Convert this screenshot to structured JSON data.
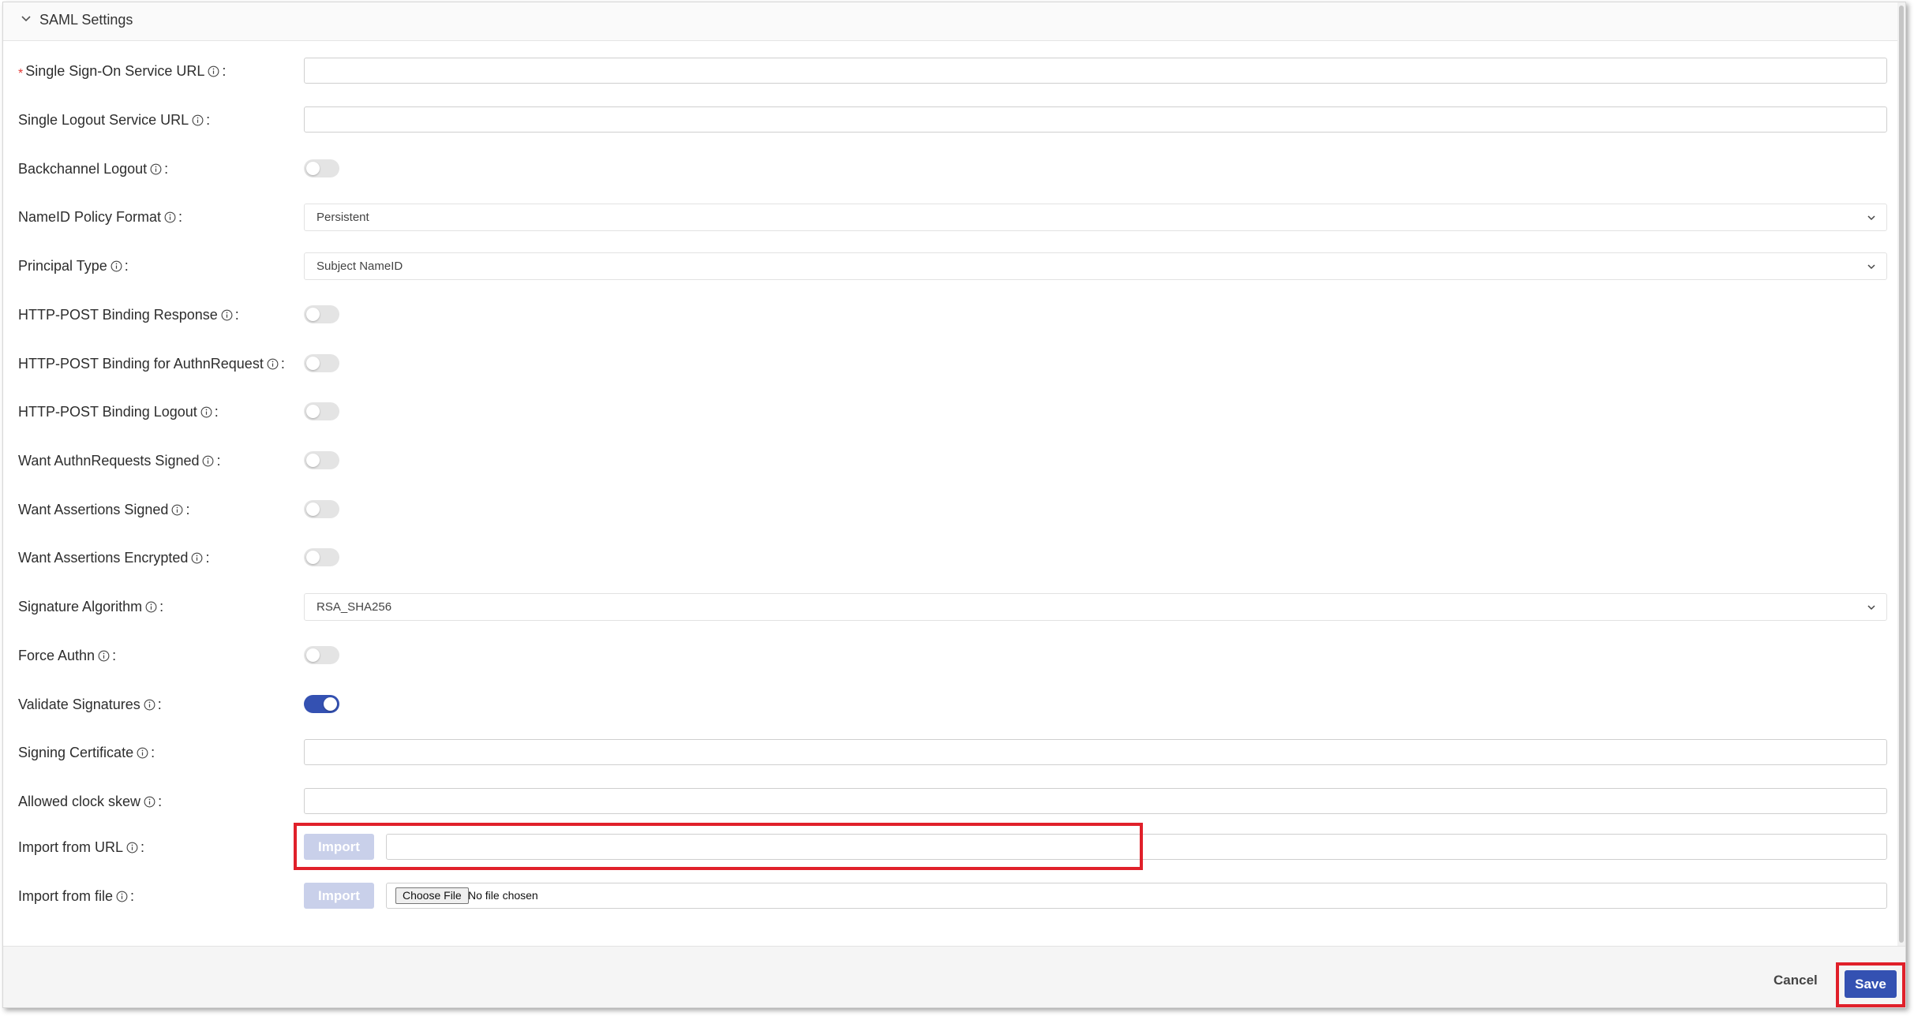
{
  "section": {
    "title": "SAML Settings",
    "chevron_icon": "chevron-down-icon"
  },
  "fields": {
    "sso_url": {
      "label": "Single Sign-On Service URL",
      "required": true,
      "value": "",
      "placeholder": ""
    },
    "slo_url": {
      "label": "Single Logout Service URL",
      "value": "",
      "placeholder": ""
    },
    "backchannel_logout": {
      "label": "Backchannel Logout",
      "enabled": false
    },
    "nameid_policy": {
      "label": "NameID Policy Format",
      "selected": "Persistent"
    },
    "principal_type": {
      "label": "Principal Type",
      "selected": "Subject NameID"
    },
    "post_binding_response": {
      "label": "HTTP-POST Binding Response",
      "enabled": false
    },
    "post_binding_authn": {
      "label": "HTTP-POST Binding for AuthnRequest",
      "enabled": false
    },
    "post_binding_logout": {
      "label": "HTTP-POST Binding Logout",
      "enabled": false
    },
    "want_authn_signed": {
      "label": "Want AuthnRequests Signed",
      "enabled": false
    },
    "want_assertions_signed": {
      "label": "Want Assertions Signed",
      "enabled": false
    },
    "want_assertions_encrypted": {
      "label": "Want Assertions Encrypted",
      "enabled": false
    },
    "signature_algorithm": {
      "label": "Signature Algorithm",
      "selected": "RSA_SHA256"
    },
    "force_authn": {
      "label": "Force Authn",
      "enabled": false
    },
    "validate_signatures": {
      "label": "Validate Signatures",
      "enabled": true
    },
    "signing_certificate": {
      "label": "Signing Certificate",
      "value": "",
      "placeholder": ""
    },
    "allowed_clock_skew": {
      "label": "Allowed clock skew",
      "value": "",
      "placeholder": ""
    },
    "import_from_url": {
      "label": "Import from URL",
      "button": "Import",
      "value": "",
      "placeholder": ""
    },
    "import_from_file": {
      "label": "Import from file",
      "button": "Import",
      "choose_label": "Choose File",
      "status": "No file chosen"
    }
  },
  "footer": {
    "cancel_label": "Cancel",
    "save_label": "Save"
  },
  "colors": {
    "accent": "#3451b2",
    "highlight": "#e0202a",
    "required": "#e53935",
    "disabled_button": "#c9d0ea"
  }
}
